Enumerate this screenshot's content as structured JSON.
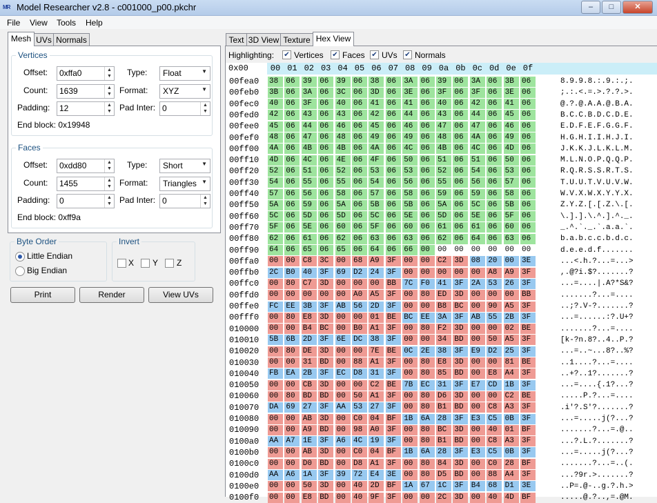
{
  "window": {
    "title": "Model Researcher v2.8 - c001000_p00.pkchr",
    "icon_text_a": "M",
    "icon_text_b": "R",
    "minimize": "–",
    "maximize": "□",
    "close": "✕"
  },
  "menu": [
    "File",
    "View",
    "Tools",
    "Help"
  ],
  "left_tabs": [
    "Mesh",
    "UVs",
    "Normals"
  ],
  "vertices": {
    "title": "Vertices",
    "offset_label": "Offset:",
    "offset": "0xffa0",
    "type_label": "Type:",
    "type": "Float",
    "count_label": "Count:",
    "count": "1639",
    "format_label": "Format:",
    "format": "XYZ",
    "padding_label": "Padding:",
    "padding": "12",
    "padinter_label": "Pad Inter:",
    "padinter": "0",
    "end_label": "End block:",
    "end": "0x19948"
  },
  "faces": {
    "title": "Faces",
    "offset_label": "Offset:",
    "offset": "0xdd80",
    "type_label": "Type:",
    "type": "Short",
    "count_label": "Count:",
    "count": "1455",
    "format_label": "Format:",
    "format": "Triangles",
    "padding_label": "Padding:",
    "padding": "0",
    "padinter_label": "Pad Inter:",
    "padinter": "0",
    "end_label": "End block:",
    "end": "0xff9a"
  },
  "byte_order": {
    "title": "Byte Order",
    "little": "Little Endian",
    "big": "Big Endian",
    "selected": "little"
  },
  "invert": {
    "title": "Invert",
    "x": "X",
    "y": "Y",
    "z": "Z"
  },
  "buttons": {
    "print": "Print",
    "render": "Render",
    "view_uvs": "View UVs"
  },
  "right_tabs": [
    "Text",
    "3D View",
    "Texture",
    "Hex View"
  ],
  "highlighting": {
    "label": "Highlighting:",
    "vertices": "Vertices",
    "faces": "Faces",
    "uvs": "UVs",
    "normals": "Normals",
    "check": "✔"
  },
  "hex": {
    "origin": "0x00",
    "columns": [
      "00",
      "01",
      "02",
      "03",
      "04",
      "05",
      "06",
      "07",
      "08",
      "09",
      "0a",
      "0b",
      "0c",
      "0d",
      "0e",
      "0f"
    ],
    "rows": [
      {
        "addr": "00fea0",
        "bytes": "38 06 39 06 39 06 38 06 3A 06 39 06 3A 06 3B 06",
        "ascii": "8.9.9.8.:.9.:.;.",
        "hl": "VVVVVVVVVVVVVVVV"
      },
      {
        "addr": "00feb0",
        "bytes": "3B 06 3A 06 3C 06 3D 06 3E 06 3F 06 3F 06 3E 06",
        "ascii": ";.:.<.=.>.?.?.>.",
        "hl": "VVVVVVVVVVVVVVVV"
      },
      {
        "addr": "00fec0",
        "bytes": "40 06 3F 06 40 06 41 06 41 06 40 06 42 06 41 06",
        "ascii": "@.?.@.A.A.@.B.A.",
        "hl": "VVVVVVVVVVVVVVVV"
      },
      {
        "addr": "00fed0",
        "bytes": "42 06 43 06 43 06 42 06 44 06 43 06 44 06 45 06",
        "ascii": "B.C.C.B.D.C.D.E.",
        "hl": "VVVVVVVVVVVVVVVV"
      },
      {
        "addr": "00fee0",
        "bytes": "45 06 44 06 46 06 45 06 46 06 47 06 47 06 46 06",
        "ascii": "E.D.F.E.F.G.G.F.",
        "hl": "VVVVVVVVVVVVVVVV"
      },
      {
        "addr": "00fef0",
        "bytes": "48 06 47 06 48 06 49 06 49 06 48 06 4A 06 49 06",
        "ascii": "H.G.H.I.I.H.J.I.",
        "hl": "VVVVVVVVVVVVVVVV"
      },
      {
        "addr": "00ff00",
        "bytes": "4A 06 4B 06 4B 06 4A 06 4C 06 4B 06 4C 06 4D 06",
        "ascii": "J.K.K.J.L.K.L.M.",
        "hl": "VVVVVVVVVVVVVVVV"
      },
      {
        "addr": "00ff10",
        "bytes": "4D 06 4C 06 4E 06 4F 06 50 06 51 06 51 06 50 06",
        "ascii": "M.L.N.O.P.Q.Q.P.",
        "hl": "VVVVVVVVVVVVVVVV"
      },
      {
        "addr": "00ff20",
        "bytes": "52 06 51 06 52 06 53 06 53 06 52 06 54 06 53 06",
        "ascii": "R.Q.R.S.S.R.T.S.",
        "hl": "VVVVVVVVVVVVVVVV"
      },
      {
        "addr": "00ff30",
        "bytes": "54 06 55 06 55 06 54 06 56 06 55 06 56 06 57 06",
        "ascii": "T.U.U.T.V.U.V.W.",
        "hl": "VVVVVVVVVVVVVVVV"
      },
      {
        "addr": "00ff40",
        "bytes": "57 06 56 06 58 06 57 06 58 06 59 06 59 06 58 06",
        "ascii": "W.V.X.W.X.Y.Y.X.",
        "hl": "VVVVVVVVVVVVVVVV"
      },
      {
        "addr": "00ff50",
        "bytes": "5A 06 59 06 5A 06 5B 06 5B 06 5A 06 5C 06 5B 06",
        "ascii": "Z.Y.Z.[.[.Z.\\.[.",
        "hl": "VVVVVVVVVVVVVVVV"
      },
      {
        "addr": "00ff60",
        "bytes": "5C 06 5D 06 5D 06 5C 06 5E 06 5D 06 5E 06 5F 06",
        "ascii": "\\.].].\\.^.].^._.",
        "hl": "VVVVVVVVVVVVVVVV"
      },
      {
        "addr": "00ff70",
        "bytes": "5F 06 5E 06 60 06 5F 06 60 06 61 06 61 06 60 06",
        "ascii": "_.^.`._.`.a.a.`.",
        "hl": "VVVVVVVVVVVVVVVV"
      },
      {
        "addr": "00ff80",
        "bytes": "62 06 61 06 62 06 63 06 63 06 62 06 64 06 63 06",
        "ascii": "b.a.b.c.c.b.d.c.",
        "hl": "VVVVVVVVVVVVVVVV"
      },
      {
        "addr": "00ff90",
        "bytes": "64 06 65 06 65 06 64 06 66 00 00 00 00 00 00 00",
        "ascii": "d.e.e.d.f.......",
        "hl": "VVVVVVVVVV------"
      },
      {
        "addr": "00ffa0",
        "bytes": "00 00 C8 3C 00 68 A9 3F 00 00 C2 3D 08 20 00 3E",
        "ascii": "...<.h.?...=...>",
        "hl": "FFFFFFFFFFFFBBBB"
      },
      {
        "addr": "00ffb0",
        "bytes": "2C B0 40 3F 69 D2 24 3F 00 00 00 00 00 A8 A9 3F",
        "ascii": ",.@?i.$?.......?",
        "hl": "BBBBBBBBFFFFFFFF"
      },
      {
        "addr": "00ffc0",
        "bytes": "00 80 C7 3D 00 00 00 BB 7C F0 41 3F 2A 53 26 3F",
        "ascii": "...=....|.A?*S&?",
        "hl": "FFFFFFFFBBBBBBBB"
      },
      {
        "addr": "00ffd0",
        "bytes": "00 00 00 00 00 A0 A5 3F 00 80 ED 3D 00 00 00 BB",
        "ascii": ".......?...=....",
        "hl": "FFFFFFFFFFFFFFFF"
      },
      {
        "addr": "00ffe0",
        "bytes": "FC EE 3B 3F AB 56 2D 3F 00 00 B8 BC 00 90 A5 3F",
        "ascii": "..;?.V-?.......?",
        "hl": "BBBBBBBBFFFFFFFF"
      },
      {
        "addr": "00fff0",
        "bytes": "00 80 E8 3D 00 00 01 BE BC EE 3A 3F AB 55 2B 3F",
        "ascii": "...=......:?.U+?",
        "hl": "FFFFFFFFBBBBBBBB"
      },
      {
        "addr": "010000",
        "bytes": "00 00 B4 BC 00 B0 A1 3F 00 80 F2 3D 00 00 02 BE",
        "ascii": ".......?...=....",
        "hl": "FFFFFFFFFFFFFFFF"
      },
      {
        "addr": "010010",
        "bytes": "5B 6B 2D 3F 6E DC 38 3F 00 00 34 BD 00 50 A5 3F",
        "ascii": "[k-?n.8?..4..P.?",
        "hl": "BBBBBBBBFFFFFFFF"
      },
      {
        "addr": "010020",
        "bytes": "00 80 DE 3D 00 00 7E BE 0C 2E 38 3F E9 D2 25 3F",
        "ascii": "...=..~...8?..%?",
        "hl": "FFFFFFFFBBBBBBBB"
      },
      {
        "addr": "010030",
        "bytes": "00 00 31 BD 00 88 A1 3F 00 80 E8 3D 00 00 81 BE",
        "ascii": "..1....?...=....",
        "hl": "FFFFFFFFFFFFFFFF"
      },
      {
        "addr": "010040",
        "bytes": "FB EA 2B 3F EC D8 31 3F 00 80 85 BD 00 E8 A4 3F",
        "ascii": "..+?..1?.......?",
        "hl": "BBBBBBBBFFFFFFFF"
      },
      {
        "addr": "010050",
        "bytes": "00 00 CB 3D 00 00 C2 BE 7B EC 31 3F E7 CD 1B 3F",
        "ascii": "...=....{.1?...?",
        "hl": "FFFFFFFFBBBBBBBB"
      },
      {
        "addr": "010060",
        "bytes": "00 80 BD BD 00 50 A1 3F 00 80 D6 3D 00 00 C2 BE",
        "ascii": ".....P.?...=....",
        "hl": "FFFFFFFFFFFFFFFF"
      },
      {
        "addr": "010070",
        "bytes": "DA 69 27 3F AA 53 27 3F 00 80 B1 BD 00 C8 A3 3F",
        "ascii": ".i'?.S'?.......?",
        "hl": "BBBBBBBBFFFFFFFF"
      },
      {
        "addr": "010080",
        "bytes": "00 00 AB 3D 00 C0 04 BF 1B 6A 28 3F E3 C5 0B 3F",
        "ascii": "...=.....j(?...?",
        "hl": "FFFFFFFFBBBBBBBB"
      },
      {
        "addr": "010090",
        "bytes": "00 00 A9 BD 00 98 A0 3F 00 80 BC 3D 00 40 01 BF",
        "ascii": ".......?...=.@..",
        "hl": "FFFFFFFFFFFFFFFF"
      },
      {
        "addr": "0100a0",
        "bytes": "AA A7 1E 3F A6 4C 19 3F 00 80 B1 BD 00 C8 A3 3F",
        "ascii": "...?.L.?.......?",
        "hl": "BBBBBBBBFFFFFFFF"
      },
      {
        "addr": "0100b0",
        "bytes": "00 00 AB 3D 00 C0 04 BF 1B 6A 28 3F E3 C5 0B 3F",
        "ascii": "...=.....j(?...?",
        "hl": "FFFFFFFFBBBBBBBB"
      },
      {
        "addr": "0100c0",
        "bytes": "00 00 D0 BD 00 D8 A1 3F 00 80 84 3D 00 C0 28 BF",
        "ascii": ".......?...=..(.",
        "hl": "FFFFFFFFFFFFFFFF"
      },
      {
        "addr": "0100d0",
        "bytes": "AA A6 1A 3F 39 72 E4 3E 00 80 D5 BD 00 88 A4 3F",
        "ascii": "...?9r.>.......?",
        "hl": "BBBBBBBBFFFFFFFF"
      },
      {
        "addr": "0100e0",
        "bytes": "00 00 50 3D 00 40 2D BF 1A 67 1C 3F B4 68 D1 3E",
        "ascii": "..P=.@-..g.?.h.>",
        "hl": "FFFFFFFFBBBBBBBB"
      },
      {
        "addr": "0100f0",
        "bytes": "00 00 E8 BD 00 40 9F 3F 00 00 2C 3D 00 40 4D BF",
        "ascii": ".....@.?..,=.@M.",
        "hl": "FFFFFFFFFFFFFFFF"
      }
    ]
  }
}
